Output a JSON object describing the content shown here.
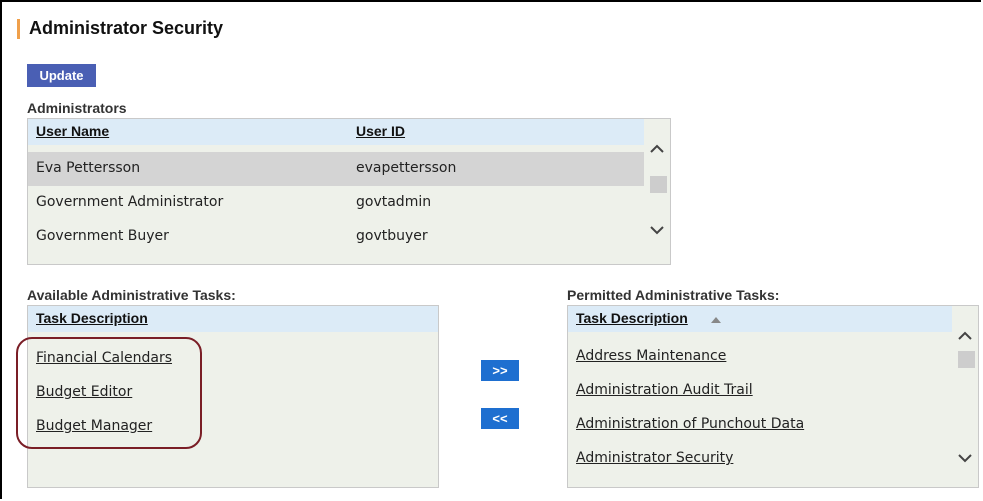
{
  "page": {
    "title": "Administrator Security",
    "update_button": "Update"
  },
  "administrators": {
    "label": "Administrators",
    "columns": [
      "User Name",
      "User ID"
    ],
    "rows": [
      {
        "name": "Eva Pettersson",
        "id": "evapettersson",
        "selected": true
      },
      {
        "name": "Government Administrator",
        "id": "govtadmin",
        "selected": false
      },
      {
        "name": "Government Buyer",
        "id": "govtbuyer",
        "selected": false
      }
    ]
  },
  "available": {
    "label": "Available Administrative Tasks:",
    "column": "Task Description",
    "items": [
      "Financial Calendars",
      "Budget Editor",
      "Budget Manager"
    ]
  },
  "permitted": {
    "label": "Permitted Administrative Tasks:",
    "column": "Task Description",
    "sort": "ascending",
    "items": [
      "Address Maintenance",
      "Administration Audit Trail",
      "Administration of Punchout Data",
      "Administrator Security"
    ]
  },
  "move": {
    "add_label": ">>",
    "remove_label": "<<"
  },
  "icons": {
    "title_marker": "title-accent-bar",
    "scroll_up": "chevron-up-icon",
    "scroll_down": "chevron-down-icon",
    "sort": "sort-ascending-icon"
  },
  "colors": {
    "accent": "#f0a04b",
    "update_button": "#4a5fb4",
    "move_button": "#1e6fd0",
    "header_bg": "#dcebf7",
    "panel_bg": "#eef1ea",
    "selected_row": "#d4d4d4",
    "highlight_ring": "#7a1e26"
  }
}
